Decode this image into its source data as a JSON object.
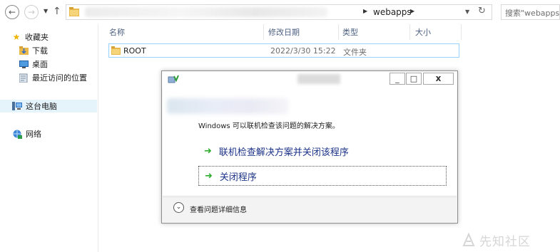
{
  "address_bar": {
    "back_icon": "arrow-left-icon",
    "forward_icon": "arrow-right-icon",
    "current_folder": "webapps",
    "search_placeholder": "搜索\"webapps\""
  },
  "sidebar": {
    "items": [
      {
        "label": "收藏夹",
        "icon": "star-icon"
      },
      {
        "label": "下载",
        "icon": "download-folder-icon"
      },
      {
        "label": "桌面",
        "icon": "desktop-icon"
      },
      {
        "label": "最近访问的位置",
        "icon": "recent-places-icon"
      },
      {
        "label": "这台电脑",
        "icon": "computer-icon"
      },
      {
        "label": "网络",
        "icon": "network-icon"
      }
    ]
  },
  "file_list": {
    "columns": [
      "名称",
      "修改日期",
      "类型",
      "大小"
    ],
    "rows": [
      {
        "name": "ROOT",
        "modified": "2022/3/30 15:22",
        "type": "文件夹",
        "size": ""
      }
    ]
  },
  "dialog": {
    "description": "Windows 可以联机检查该问题的解决方案。",
    "options": [
      "联机检查解决方案并关闭该程序",
      "关闭程序"
    ],
    "details_label": "查看问题详细信息",
    "window_buttons": {
      "minimize": "_",
      "maximize": "□",
      "close": "x"
    }
  },
  "watermark": {
    "text": "先知社区"
  },
  "colors": {
    "link_text": "#1c3388",
    "arrow_green": "#2fae2f",
    "selection_border": "#99d1ff",
    "header_text": "#4d6082"
  }
}
